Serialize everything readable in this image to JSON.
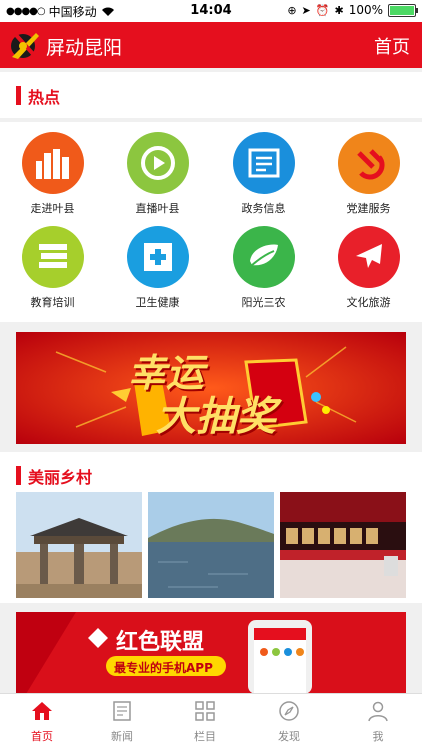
{
  "status_bar": {
    "carrier": "中国移动",
    "time": "14:04",
    "battery": "100%"
  },
  "header": {
    "title": "屏动昆阳",
    "home_link": "首页"
  },
  "hot_section": {
    "title": "热点"
  },
  "services": [
    {
      "label": "走进叶县",
      "color": "#f05a1a",
      "icon": "city-icon"
    },
    {
      "label": "直播叶县",
      "color": "#8cc63f",
      "icon": "play-icon"
    },
    {
      "label": "政务信息",
      "color": "#1a8fdc",
      "icon": "document-icon"
    },
    {
      "label": "党建服务",
      "color": "#f0851a",
      "icon": "party-emblem-icon"
    },
    {
      "label": "教育培训",
      "color": "#a6cf2c",
      "icon": "books-icon"
    },
    {
      "label": "卫生健康",
      "color": "#1a9ee0",
      "icon": "medical-cross-icon"
    },
    {
      "label": "阳光三农",
      "color": "#3bb54a",
      "icon": "leaf-icon"
    },
    {
      "label": "文化旅游",
      "color": "#e8202a",
      "icon": "airplane-icon"
    }
  ],
  "lottery_banner": {
    "line1": "幸运",
    "line2": "大抽奖"
  },
  "village_section": {
    "title": "美丽乡村"
  },
  "photos": [
    {
      "name": "archway-photo"
    },
    {
      "name": "lake-photo"
    },
    {
      "name": "stage-photo"
    }
  ],
  "alliance_banner": {
    "title": "红色联盟",
    "slogan": "最专业的手机APP"
  },
  "tabbar": [
    {
      "label": "首页",
      "icon": "home-icon",
      "active": true
    },
    {
      "label": "新闻",
      "icon": "news-icon",
      "active": false
    },
    {
      "label": "栏目",
      "icon": "grid-icon",
      "active": false
    },
    {
      "label": "发现",
      "icon": "compass-icon",
      "active": false
    },
    {
      "label": "我",
      "icon": "user-icon",
      "active": false
    }
  ]
}
